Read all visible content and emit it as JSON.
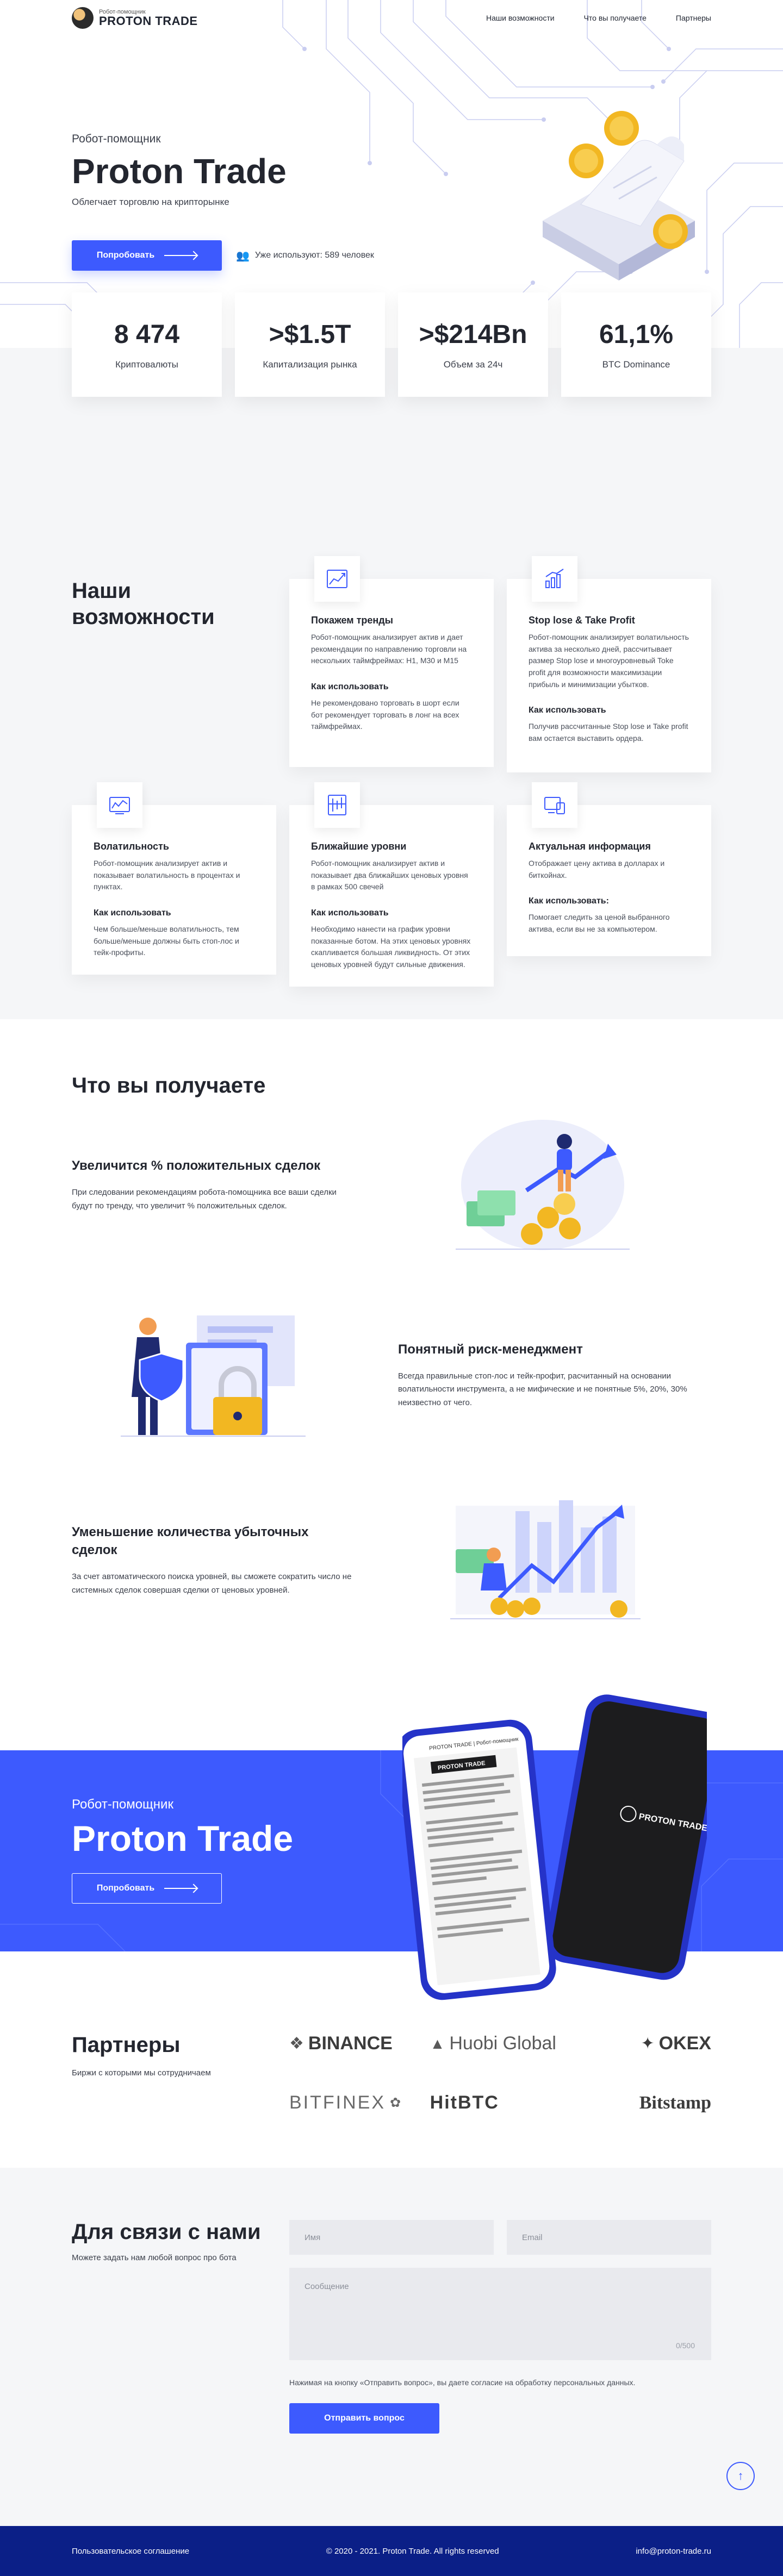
{
  "header": {
    "logo_small": "Робот-помощник",
    "logo_big": "PROTON TRADE",
    "nav": [
      "Наши возможности",
      "Что вы получаете",
      "Партнеры"
    ]
  },
  "hero": {
    "subtitle": "Робот-помощник",
    "title": "Proton Trade",
    "description": "Облегчает торговлю на крипторынке",
    "cta_label": "Попробовать",
    "users_text": "Уже используют: 589 человек"
  },
  "stats": [
    {
      "value": "8 474",
      "label": "Криптовалюты"
    },
    {
      "value": ">$1.5T",
      "label": "Капитализация рынка"
    },
    {
      "value": ">$214Bn",
      "label": "Объем за 24ч"
    },
    {
      "value": "61,1%",
      "label": "BTC Dominance"
    }
  ],
  "features": {
    "title_line1": "Наши",
    "title_line2": "возможности",
    "how_label": "Как использовать",
    "how_label_colon": "Как использовать:",
    "items": [
      {
        "icon": "trend-chart-icon",
        "title": "Покажем тренды",
        "text": "Робот-помощник анализирует актив и дает рекомендации по направлению торговли на нескольких таймфреймах: H1, M30 и M15",
        "how": "Не рекомендовано торговать в шорт если бот рекомендует торговать в лонг на всех таймфреймах."
      },
      {
        "icon": "growth-chart-icon",
        "title": "Stop lose & Take Profit",
        "text": "Робот-помощник анализирует волатильность актива за несколько дней, рассчитывает размер Stop lose и многоуровневый Toke profit для возможности максимизации прибыль и минимизации убытков.",
        "how": "Получив рассчитанные Stop lose и Take profit вам остается выставить ордера."
      },
      {
        "icon": "volatility-icon",
        "title": "Волатильность",
        "text": "Робот-помощник анализирует актив и показывает волатильность в процентах и пунктах.",
        "how": "Чем больше/меньше волатильность, тем больше/меньше должны быть стоп-лос и тейк-профиты."
      },
      {
        "icon": "levels-icon",
        "title": "Ближайшие уровни",
        "text": "Робот-помощник анализирует актив и показывает два ближайших ценовых уровня в рамках 500 свечей",
        "how": "Необходимо нанести на график уровни показанные ботом. На этих ценовых уровнях скапливается большая ликвидность. От этих ценовых уровней будут сильные движения."
      },
      {
        "icon": "monitor-icon",
        "title": "Актуальная информация",
        "text": "Отображает цену актива в долларах и биткойнах.",
        "how": "Помогает следить за ценой выбранного актива, если вы не за компьютером."
      }
    ]
  },
  "benefits": {
    "title": "Что вы получаете",
    "items": [
      {
        "title": "Увеличится % положительных сделок",
        "text": "При следовании рекомендациям робота-помощника все ваши сделки будут по тренду, что увеличит % положительных сделок."
      },
      {
        "title": "Понятный риск-менеджмент",
        "text": "Всегда правильные стоп-лос и тейк-профит, расчитанный на основании волатильности инструмента, а не мифические и не понятные 5%, 20%, 30% неизвестно от чего."
      },
      {
        "title": "Уменьшение количества убыточных сделок",
        "text": "За счет автоматического поиска уровней, вы сможете сократить число не системных сделок совершая сделки от ценовых уровней."
      }
    ]
  },
  "promo": {
    "subtitle": "Робот-помощник",
    "title": "Proton Trade",
    "cta_label": "Попробовать",
    "phone_header": "PROTON TRADE",
    "phone_chat_title": "PROTON TRADE | Робот-помощник",
    "phone_logo": "PROTON TRADE"
  },
  "partners": {
    "title": "Партнеры",
    "description": "Биржи с которыми мы сотрудничаем",
    "logos": [
      "BINANCE",
      "Huobi Global",
      "OKEX",
      "BITFINEX",
      "HitBTC",
      "Bitstamp"
    ]
  },
  "contact": {
    "title": "Для связи с нами",
    "description": "Можете задать нам любой вопрос про бота",
    "name_placeholder": "Имя",
    "email_placeholder": "Email",
    "message_placeholder": "Сообщение",
    "counter": "0/500",
    "consent": "Нажимая на кнопку «Отправить вопрос», вы даете согласие на обработку персональных данных.",
    "submit_label": "Отправить вопрос"
  },
  "footer": {
    "agreement": "Пользовательское соглашение",
    "copyright": "© 2020 - 2021. Proton Trade. All rights reserved",
    "email": "info@proton-trade.ru"
  },
  "colors": {
    "accent": "#3d5afe",
    "footer": "#0b1f87",
    "band": "#f5f6f8"
  }
}
